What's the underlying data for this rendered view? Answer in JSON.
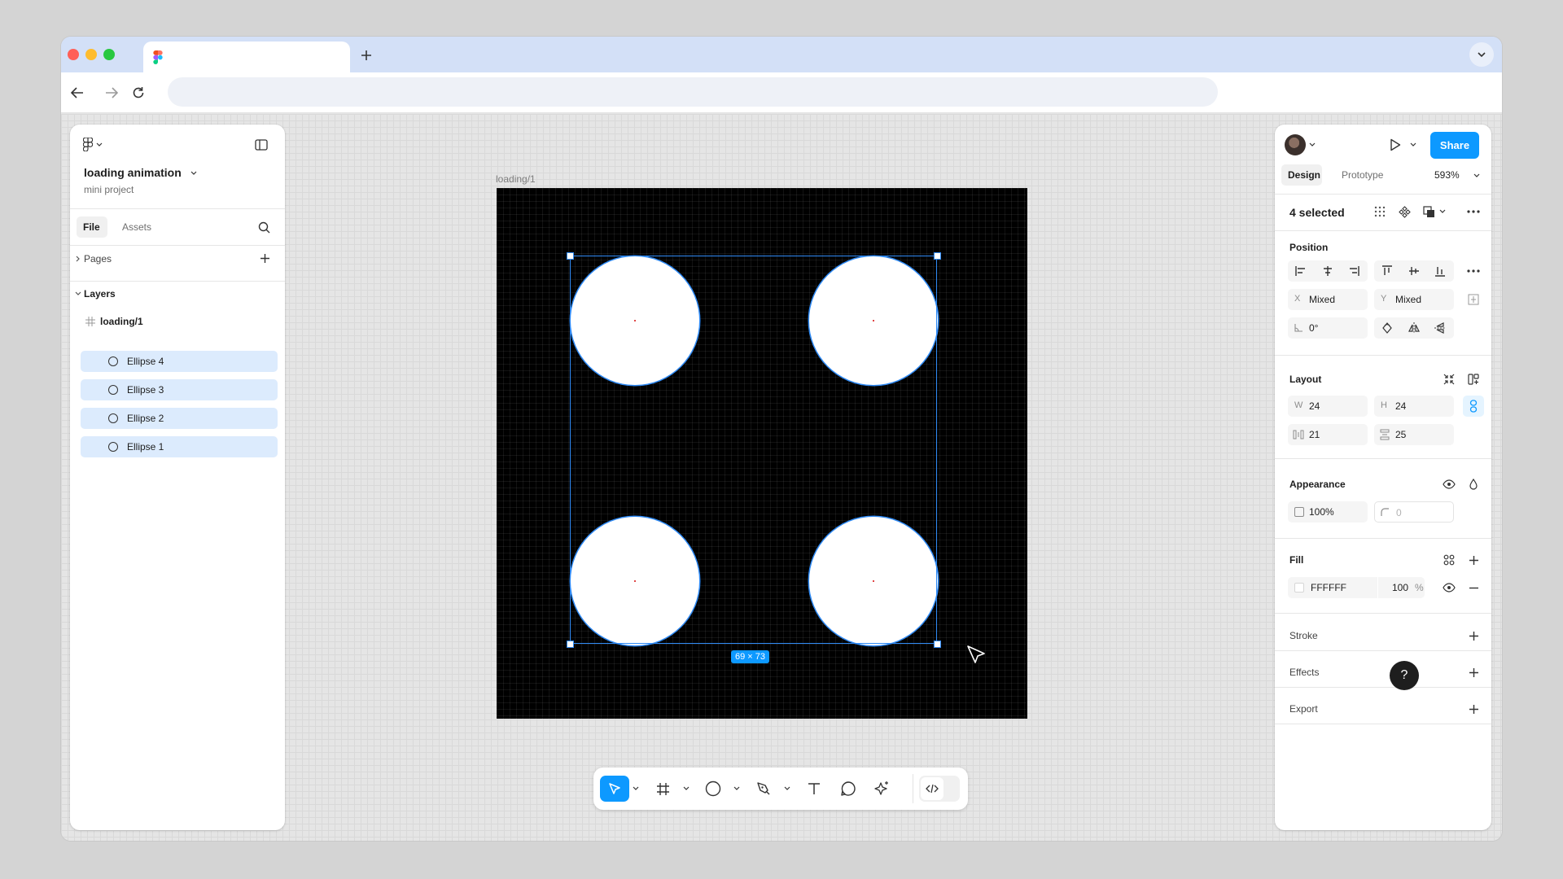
{
  "browser": {
    "tab_title": "",
    "url": "",
    "icons": [
      "figma-favicon",
      "plus-icon",
      "chevron-down-icon",
      "back-icon",
      "forward-icon",
      "reload-icon"
    ]
  },
  "left_panel": {
    "file_name": "loading animation",
    "project_name": "mini project",
    "tabs": [
      "File",
      "Assets"
    ],
    "pages_label": "Pages",
    "layers_label": "Layers",
    "frame_layer": "loading/1",
    "layers": [
      "Ellipse 4",
      "Ellipse 3",
      "Ellipse 2",
      "Ellipse 1"
    ]
  },
  "canvas": {
    "frame_label": "loading/1",
    "selection_size": "69 × 73"
  },
  "right_panel": {
    "share_label": "Share",
    "tabs": {
      "design": "Design",
      "prototype": "Prototype"
    },
    "zoom": "593%",
    "selection_count": "4 selected",
    "position": {
      "title": "Position",
      "x_label": "X",
      "x_value": "Mixed",
      "y_label": "Y",
      "y_value": "Mixed",
      "rotation": "0°"
    },
    "layout": {
      "title": "Layout",
      "w_label": "W",
      "w_value": "24",
      "h_label": "H",
      "h_value": "24",
      "gap_h": "21",
      "gap_v": "25"
    },
    "appearance": {
      "title": "Appearance",
      "opacity": "100%",
      "radius": "0"
    },
    "fill": {
      "title": "Fill",
      "hex": "FFFFFF",
      "opacity": "100",
      "unit": "%"
    },
    "stroke_title": "Stroke",
    "effects_title": "Effects",
    "export_title": "Export"
  },
  "help_label": "?",
  "colors": {
    "accent": "#0d99ff",
    "selection": "#2f8af5",
    "layer_highlight": "#dcebfd",
    "frame_bg": "#000000",
    "ellipse_fill": "#FFFFFF"
  }
}
